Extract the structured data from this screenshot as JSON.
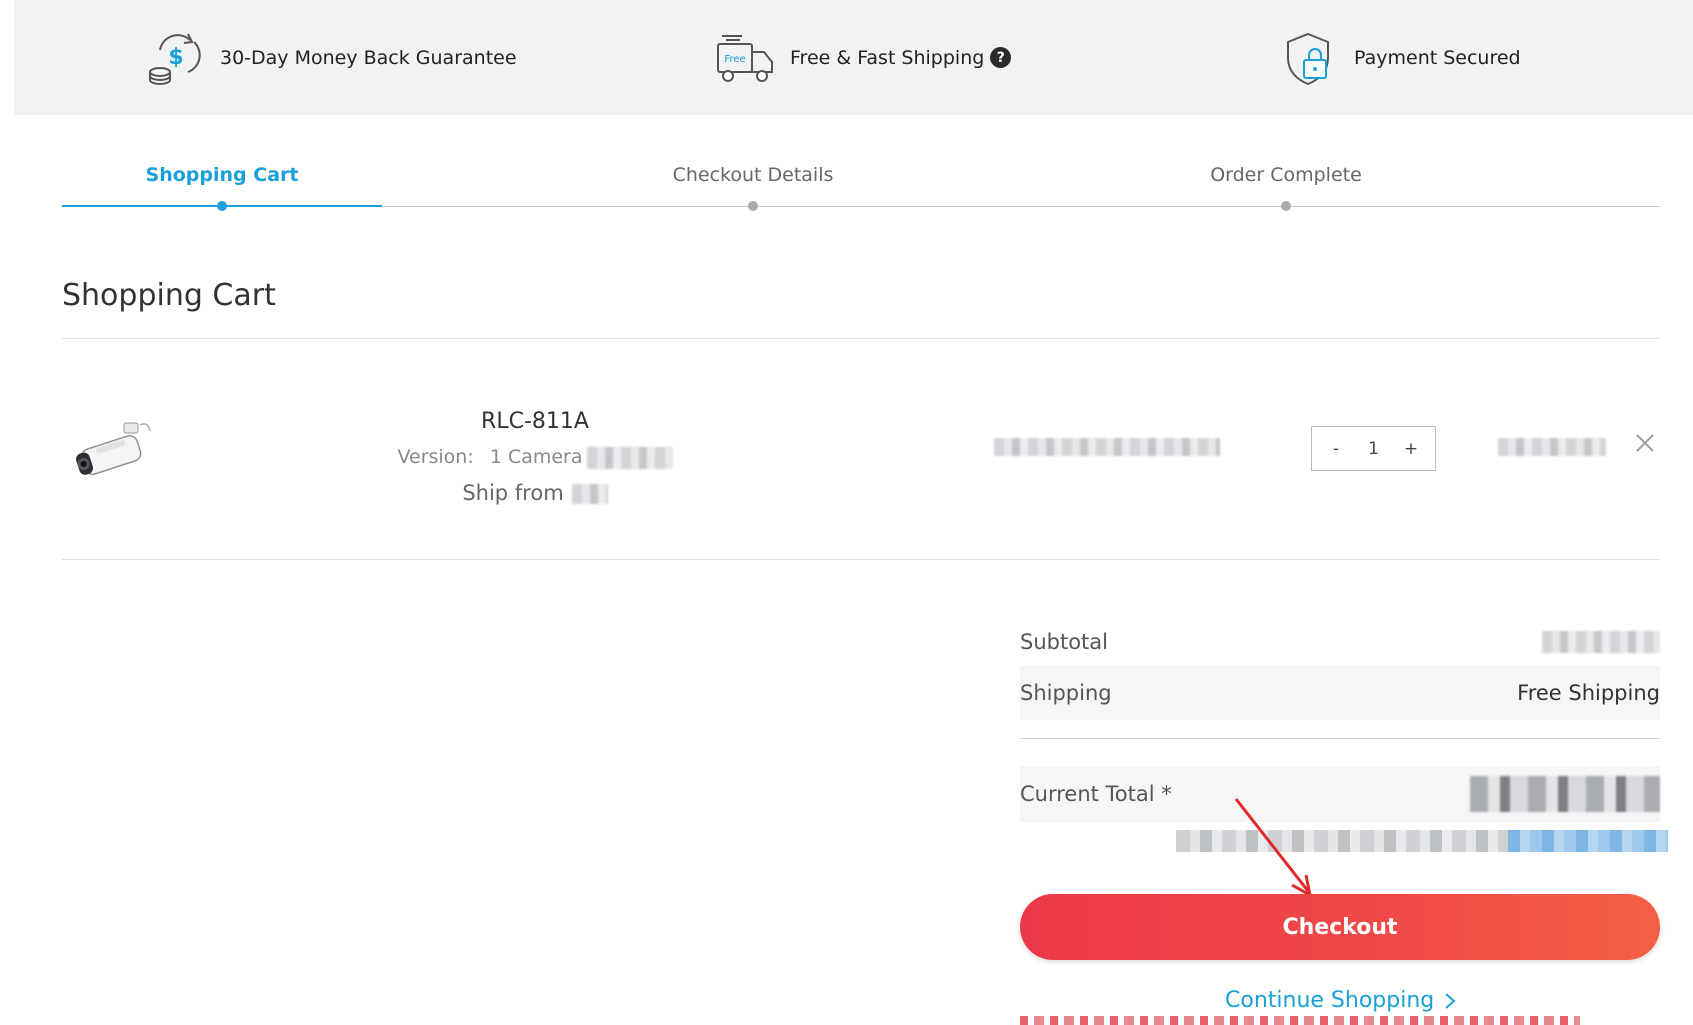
{
  "benefits": [
    {
      "label": "30-Day Money Back Guarantee",
      "icon": "money-back-icon"
    },
    {
      "label": "Free & Fast Shipping",
      "icon": "free-shipping-truck-icon",
      "help": "?",
      "truck_text": "Free"
    },
    {
      "label": "Payment Secured",
      "icon": "secure-payment-shield-icon"
    }
  ],
  "steps": [
    {
      "label": "Shopping Cart",
      "active": true
    },
    {
      "label": "Checkout Details",
      "active": false
    },
    {
      "label": "Order Complete",
      "active": false
    }
  ],
  "page_title": "Shopping Cart",
  "cart_item": {
    "name": "RLC-811A",
    "version_label": "Version:",
    "version_value": "1 Camera",
    "ship_label": "Ship from",
    "quantity": "1",
    "qty_minus": "-",
    "qty_plus": "+"
  },
  "summary": {
    "subtotal_label": "Subtotal",
    "shipping_label": "Shipping",
    "shipping_value": "Free Shipping",
    "total_label": "Current Total *"
  },
  "checkout_label": "Checkout",
  "continue_label": "Continue Shopping",
  "colors": {
    "accent": "#1aa0d8",
    "checkout_start": "#ea3848",
    "checkout_end": "#f35f44",
    "bar_bg": "#f1f2f4"
  }
}
